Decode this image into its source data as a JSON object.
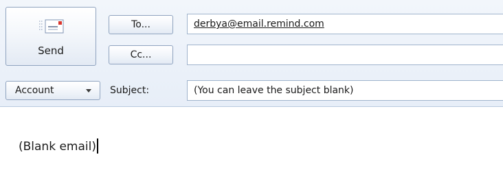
{
  "buttons": {
    "send_label": "Send",
    "to_label": "To...",
    "cc_label": "Cc...",
    "account_label": "Account"
  },
  "labels": {
    "subject": "Subject:"
  },
  "fields": {
    "to_value": "derbya@email.remind.com",
    "cc_value": "",
    "subject_value": "(You can leave the subject blank)"
  },
  "message": {
    "body_text": "(Blank email)"
  },
  "icons": {
    "send": "send-mail-icon",
    "account_dropdown": "chevron-down-icon"
  },
  "colors": {
    "header_background": "#e7eef8",
    "field_border": "#9fb3cc",
    "button_border": "#8fa3bf",
    "send_icon_accent": "#d9342b"
  }
}
